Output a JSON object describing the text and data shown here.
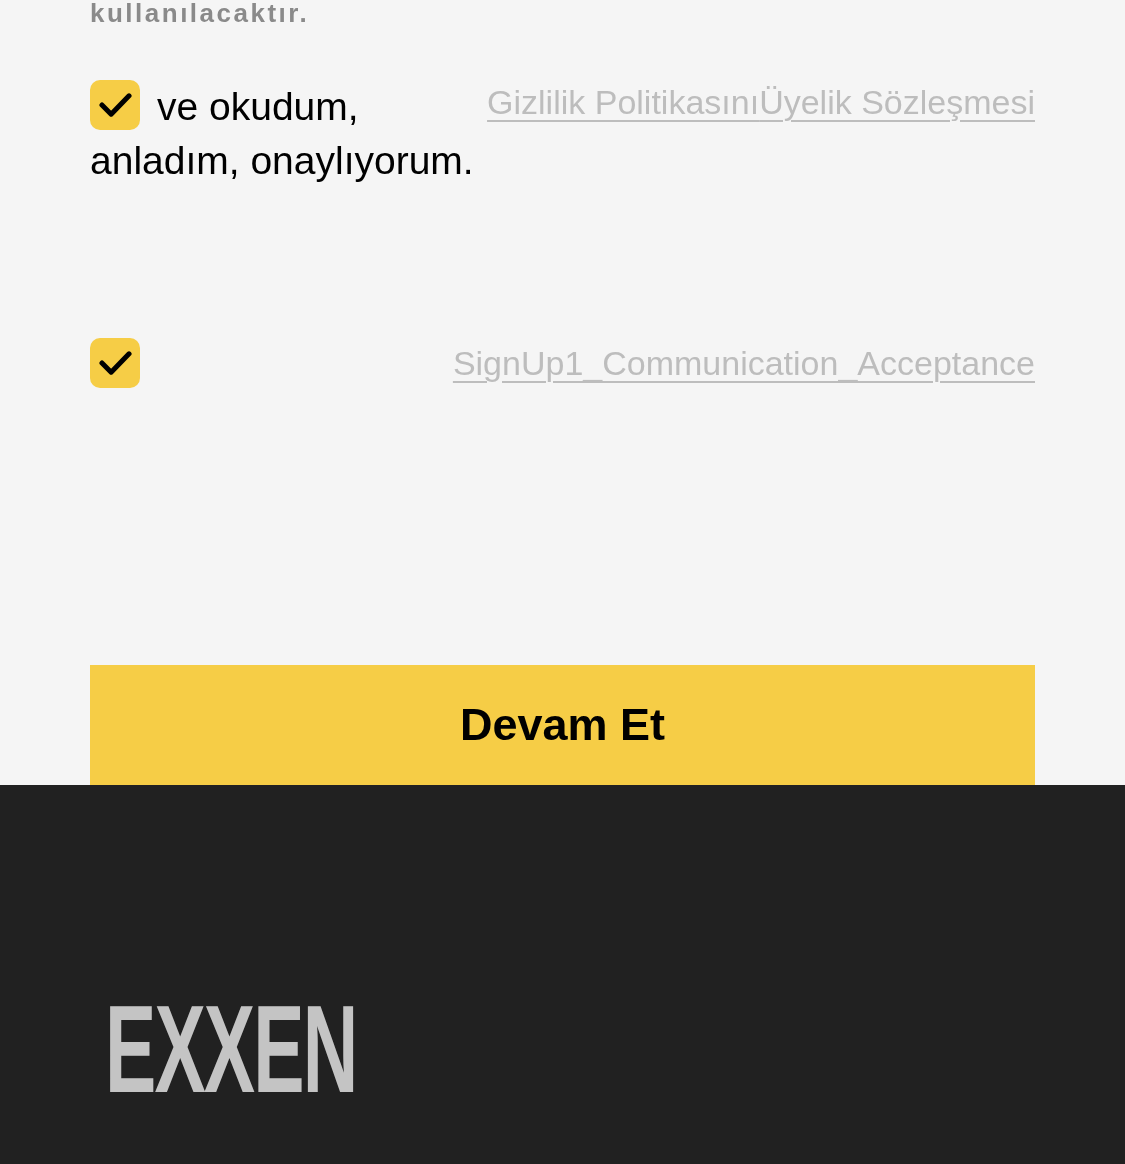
{
  "notice": {
    "text": "kullanılacaktır."
  },
  "consents": [
    {
      "checked": true,
      "lines": [
        "ve okudum,",
        "anladım, onaylıyorum."
      ],
      "links": [
        "Gizlilik Politikasını",
        "Üyelik Sözleşmesi"
      ]
    },
    {
      "checked": true,
      "links": [
        "SignUp1_Communication_Acceptance"
      ]
    }
  ],
  "continue_button": {
    "label": "Devam Et"
  },
  "footer": {
    "logo": "EXXEN"
  }
}
